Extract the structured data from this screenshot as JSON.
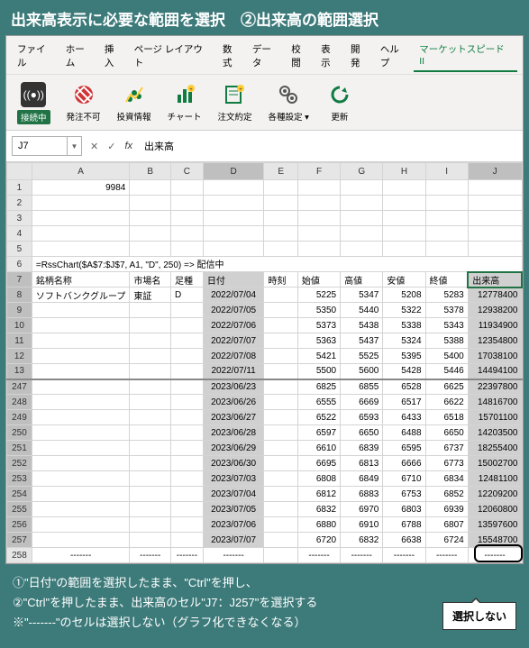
{
  "title": "出来高表示に必要な範囲を選択　②出来高の範囲選択",
  "menu": [
    "ファイル",
    "ホーム",
    "挿入",
    "ページ レイアウト",
    "数式",
    "データ",
    "校閲",
    "表示",
    "開発",
    "ヘルプ",
    "マーケットスピード II"
  ],
  "ribbon": {
    "conn": "接続中",
    "order": "発注不可",
    "invest": "投資情報",
    "chart": "チャート",
    "exec": "注文約定",
    "settings": "各種設定",
    "refresh": "更新"
  },
  "nameBox": "J7",
  "formula": "出来高",
  "cols": [
    "A",
    "B",
    "C",
    "D",
    "E",
    "F",
    "G",
    "H",
    "I",
    "J"
  ],
  "a1": "9984",
  "row6": "=RssChart($A$7:$J$7, A1, \"D\", 250) => 配信中",
  "header7": {
    "A": "銘柄名称",
    "B": "市場名",
    "C": "足種",
    "D": "日付",
    "E": "時刻",
    "F": "始値",
    "G": "高値",
    "H": "安値",
    "I": "終値",
    "J": "出来高"
  },
  "row8": {
    "A": "ソフトバンクグループ",
    "B": "東証",
    "C": "D"
  },
  "dataRows": [
    {
      "r": "8",
      "D": "2022/07/04",
      "F": "5225",
      "G": "5347",
      "H": "5208",
      "I": "5283",
      "J": "12778400"
    },
    {
      "r": "9",
      "D": "2022/07/05",
      "F": "5350",
      "G": "5440",
      "H": "5322",
      "I": "5378",
      "J": "12938200"
    },
    {
      "r": "10",
      "D": "2022/07/06",
      "F": "5373",
      "G": "5438",
      "H": "5338",
      "I": "5343",
      "J": "11934900"
    },
    {
      "r": "11",
      "D": "2022/07/07",
      "F": "5363",
      "G": "5437",
      "H": "5324",
      "I": "5388",
      "J": "12354800"
    },
    {
      "r": "12",
      "D": "2022/07/08",
      "F": "5421",
      "G": "5525",
      "H": "5395",
      "I": "5400",
      "J": "17038100"
    },
    {
      "r": "13",
      "D": "2022/07/11",
      "F": "5500",
      "G": "5600",
      "H": "5428",
      "I": "5446",
      "J": "14494100"
    },
    {
      "r": "247",
      "D": "2023/06/23",
      "F": "6825",
      "G": "6855",
      "H": "6528",
      "I": "6625",
      "J": "22397800"
    },
    {
      "r": "248",
      "D": "2023/06/26",
      "F": "6555",
      "G": "6669",
      "H": "6517",
      "I": "6622",
      "J": "14816700"
    },
    {
      "r": "249",
      "D": "2023/06/27",
      "F": "6522",
      "G": "6593",
      "H": "6433",
      "I": "6518",
      "J": "15701100"
    },
    {
      "r": "250",
      "D": "2023/06/28",
      "F": "6597",
      "G": "6650",
      "H": "6488",
      "I": "6650",
      "J": "14203500"
    },
    {
      "r": "251",
      "D": "2023/06/29",
      "F": "6610",
      "G": "6839",
      "H": "6595",
      "I": "6737",
      "J": "18255400"
    },
    {
      "r": "252",
      "D": "2023/06/30",
      "F": "6695",
      "G": "6813",
      "H": "6666",
      "I": "6773",
      "J": "15002700"
    },
    {
      "r": "253",
      "D": "2023/07/03",
      "F": "6808",
      "G": "6849",
      "H": "6710",
      "I": "6834",
      "J": "12481100"
    },
    {
      "r": "254",
      "D": "2023/07/04",
      "F": "6812",
      "G": "6883",
      "H": "6753",
      "I": "6852",
      "J": "12209200"
    },
    {
      "r": "255",
      "D": "2023/07/05",
      "F": "6832",
      "G": "6970",
      "H": "6803",
      "I": "6939",
      "J": "12060800"
    },
    {
      "r": "256",
      "D": "2023/07/06",
      "F": "6880",
      "G": "6910",
      "H": "6788",
      "I": "6807",
      "J": "13597600"
    },
    {
      "r": "257",
      "D": "2023/07/07",
      "F": "6720",
      "G": "6832",
      "H": "6638",
      "I": "6724",
      "J": "15548700"
    }
  ],
  "dash": "-------",
  "notes": {
    "l1": "①\"日付\"の範囲を選択したまま、\"Ctrl\"を押し、",
    "l2": "②\"Ctrl\"を押したまま、出来高のセル\"J7：J257\"を選択する",
    "l3": "※\"-------\"のセルは選択しない（グラフ化できなくなる）"
  },
  "callout": "選択しない"
}
